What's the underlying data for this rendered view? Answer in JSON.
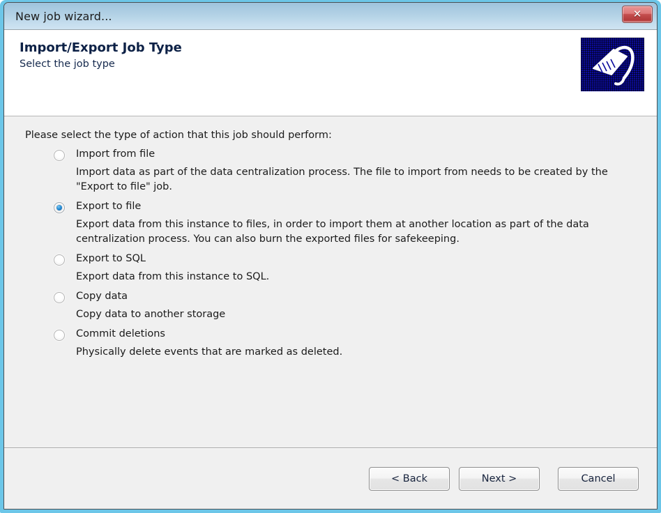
{
  "window": {
    "title": "New job wizard...",
    "close_label": "✕"
  },
  "header": {
    "title": "Import/Export Job Type",
    "subtitle": "Select the job type",
    "icon_name": "wizard-basket-icon"
  },
  "main": {
    "intro": "Please select the type of action that this job should perform:",
    "options": [
      {
        "label": "Import from file",
        "description": "Import data as part of the data centralization process. The file to import from needs to be created by the \"Export to file\" job.",
        "selected": false
      },
      {
        "label": "Export to file",
        "description": "Export data from this instance to files, in order to import them at another location as part of the data centralization process. You can also burn the exported files for safekeeping.",
        "selected": true
      },
      {
        "label": "Export to SQL",
        "description": "Export data from this instance to SQL.",
        "selected": false
      },
      {
        "label": "Copy data",
        "description": "Copy data to another storage",
        "selected": false
      },
      {
        "label": "Commit deletions",
        "description": "Physically delete events that are marked as deleted.",
        "selected": false
      }
    ]
  },
  "footer": {
    "back_label": "< Back",
    "next_label": "Next >",
    "cancel_label": "Cancel"
  },
  "colors": {
    "titlebar_start": "#9ec3dd",
    "titlebar_end": "#cfe4f2",
    "frame": "#6cc6e8",
    "body_background": "#f0f0f0",
    "header_title": "#0d2146",
    "close_button": "#c54f4f",
    "radio_selected": "#2b8fd6",
    "icon_background": "#0b0b9c"
  }
}
